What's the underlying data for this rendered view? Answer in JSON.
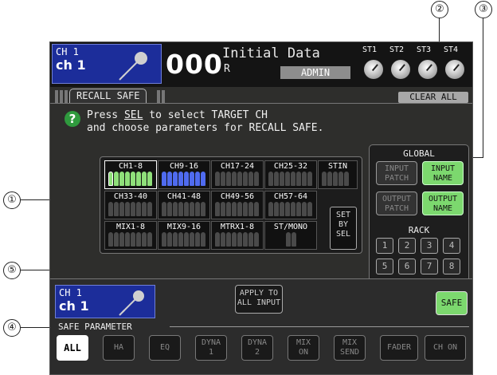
{
  "channel": {
    "number": "CH 1",
    "name": "ch 1"
  },
  "scene": {
    "number": "000",
    "title": "Initial Data",
    "sub": "R",
    "user": "ADMIN"
  },
  "st_knobs": [
    "ST1",
    "ST2",
    "ST3",
    "ST4"
  ],
  "tab": {
    "label": "RECALL SAFE"
  },
  "clear_all_label": "CLEAR ALL",
  "message": {
    "line1_pre": "Press ",
    "line1_sel": "SEL",
    "line1_post": " to select TARGET CH",
    "line2": "and choose parameters for RECALL SAFE."
  },
  "channel_groups": {
    "row1": [
      "CH1-8",
      "CH9-16",
      "CH17-24",
      "CH25-32",
      "STIN"
    ],
    "row2": [
      "CH33-40",
      "CH41-48",
      "CH49-56",
      "CH57-64"
    ],
    "row3": [
      "MIX1-8",
      "MIX9-16",
      "MTRX1-8",
      "ST/MONO"
    ],
    "set_by_sel": [
      "SET",
      "BY",
      "SEL"
    ]
  },
  "global": {
    "title": "GLOBAL",
    "input_patch": [
      "INPUT",
      "PATCH"
    ],
    "input_name": [
      "INPUT",
      "NAME"
    ],
    "output_patch": [
      "OUTPUT",
      "PATCH"
    ],
    "output_name": [
      "OUTPUT",
      "NAME"
    ],
    "rack_title": "RACK",
    "racks": [
      "1",
      "2",
      "3",
      "4",
      "5",
      "6",
      "7",
      "8"
    ]
  },
  "apply_to_all": [
    "APPLY TO",
    "ALL INPUT"
  ],
  "safe_label": "SAFE",
  "safe_parameter_title": "SAFE PARAMETER",
  "params": [
    [
      "ALL"
    ],
    [
      "HA"
    ],
    [
      "EQ"
    ],
    [
      "DYNA",
      "1"
    ],
    [
      "DYNA",
      "2"
    ],
    [
      "MIX",
      "ON"
    ],
    [
      "MIX",
      "SEND"
    ],
    [
      "FADER"
    ],
    [
      "CH ON"
    ]
  ],
  "callouts": [
    "①",
    "②",
    "③",
    "④",
    "⑤"
  ],
  "colors": {
    "accent_green": "#7cd86e",
    "channel_blue": "#1c2d9a",
    "fader_green": "#8fe07a",
    "fader_blue": "#4f6bf0"
  }
}
